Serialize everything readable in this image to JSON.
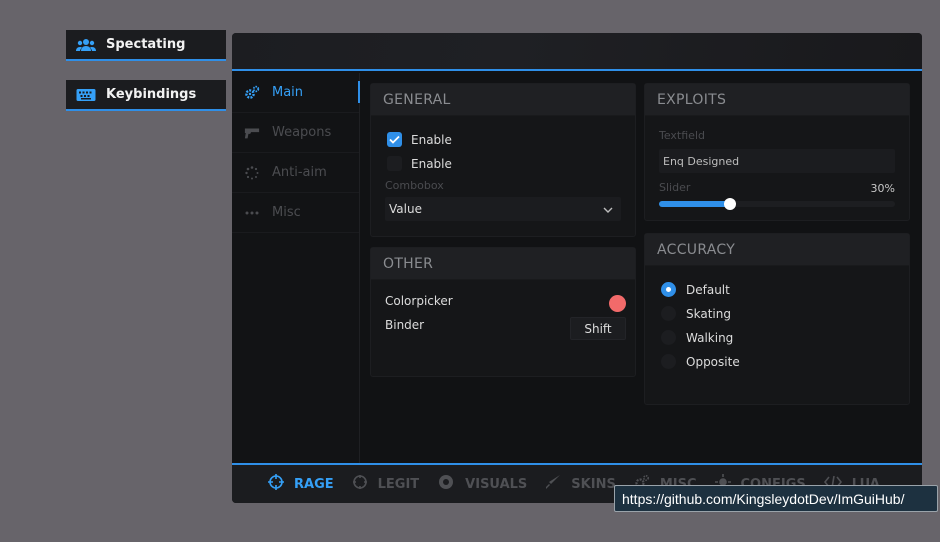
{
  "windows": {
    "spectating": {
      "title": "Spectating",
      "icon": "users-icon"
    },
    "keybindings": {
      "title": "Keybindings",
      "icon": "keyboard-icon"
    }
  },
  "sidebar": {
    "items": [
      {
        "label": "Main",
        "icon": "gears-icon",
        "active": true
      },
      {
        "label": "Weapons",
        "icon": "pistol-icon",
        "active": false
      },
      {
        "label": "Anti-aim",
        "icon": "spinner-icon",
        "active": false
      },
      {
        "label": "Misc",
        "icon": "dots-icon",
        "active": false
      }
    ]
  },
  "general": {
    "title": "GENERAL",
    "checkbox1": {
      "label": "Enable",
      "checked": true
    },
    "checkbox2": {
      "label": "Enable",
      "checked": false
    },
    "combobox_label": "Combobox",
    "combobox_value": "Value"
  },
  "other": {
    "title": "OTHER",
    "colorpicker_label": "Colorpicker",
    "colorpicker_color": "#f26a6a",
    "binder_label": "Binder",
    "binder_value": "Shift"
  },
  "exploits": {
    "title": "EXPLOITS",
    "textfield_label": "Textfield",
    "textfield_value": "Enq Designed",
    "slider_label": "Slider",
    "slider_value_text": "30%",
    "slider_fraction": 0.3
  },
  "accuracy": {
    "title": "ACCURACY",
    "options": [
      {
        "label": "Default",
        "selected": true
      },
      {
        "label": "Skating",
        "selected": false
      },
      {
        "label": "Walking",
        "selected": false
      },
      {
        "label": "Opposite",
        "selected": false
      }
    ]
  },
  "tabs": [
    {
      "label": "RAGE",
      "icon": "crosshair-icon",
      "active": true
    },
    {
      "label": "LEGIT",
      "icon": "target-icon",
      "active": false
    },
    {
      "label": "VISUALS",
      "icon": "eye-icon",
      "active": false
    },
    {
      "label": "SKINS",
      "icon": "knife-icon",
      "active": false
    },
    {
      "label": "MISC",
      "icon": "gears-icon",
      "active": false
    },
    {
      "label": "CONFIGS",
      "icon": "sun-icon",
      "active": false
    },
    {
      "label": "LUA",
      "icon": "code-icon",
      "active": false
    }
  ],
  "tooltip": {
    "text": "https://github.com/KingsleydotDev/ImGuiHub/"
  },
  "colors": {
    "accent": "#2f8fe8",
    "accent_text": "#35a0f7",
    "background": "#67646a",
    "panel": "#151618"
  }
}
